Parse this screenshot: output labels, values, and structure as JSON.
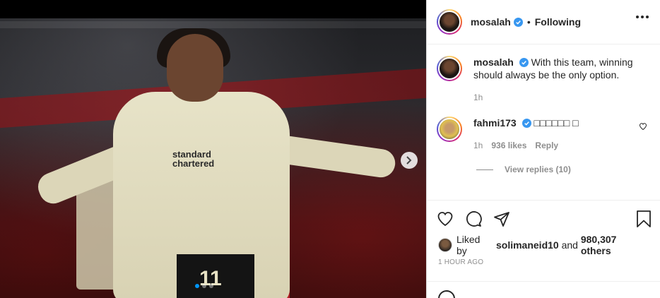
{
  "post": {
    "author": "mosalah",
    "follow_state": "Following",
    "separator": "•",
    "photo": {
      "sponsor_text_1": "standard",
      "sponsor_text_2": "chartered",
      "shirt_number": "11"
    }
  },
  "caption": {
    "username": "mosalah",
    "text": "With this team, winning should always be the only option.",
    "time": "1h"
  },
  "comments": [
    {
      "username": "fahmi173",
      "text": "□□□□□□ □",
      "time": "1h",
      "likes": "936 likes",
      "reply_label": "Reply",
      "view_replies": "View replies (10)"
    }
  ],
  "likes": {
    "prefix": "Liked by ",
    "user": "solimaneid10",
    "middle": " and ",
    "others": "980,307 others"
  },
  "timestamp": "1 hour ago",
  "colors": {
    "verified": "#3897f0",
    "text": "#262626",
    "muted": "#8e8e8e"
  },
  "icons": [
    "more-icon",
    "verified-icon",
    "heart-icon",
    "comment-icon",
    "share-icon",
    "save-icon",
    "next-arrow-icon",
    "emoji-icon"
  ]
}
